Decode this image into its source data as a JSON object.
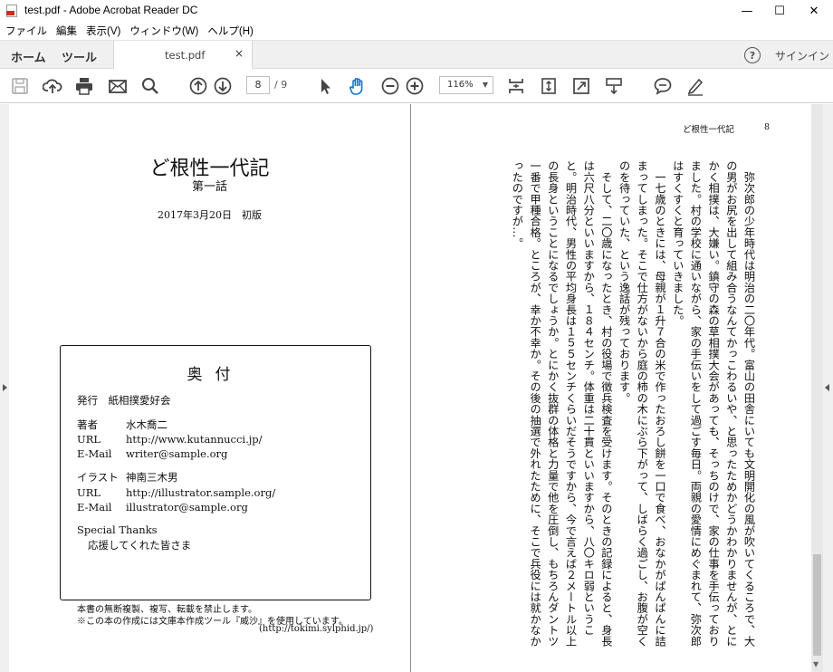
{
  "window": {
    "title": "test.pdf - Adobe Acrobat Reader DC",
    "minimize": "—",
    "maximize": "☐",
    "close": "✕"
  },
  "menu": [
    "ファイル",
    "編集",
    "表示(V)",
    "ウィンドウ(W)",
    "ヘルプ(H)"
  ],
  "tabs": {
    "home": "ホーム",
    "tools": "ツール",
    "document": "test.pdf",
    "close": "×",
    "help": "?",
    "signin": "サインイン"
  },
  "toolbar": {
    "page_current": "8",
    "page_total": "/ 9",
    "zoom": "116%",
    "icons": [
      "save-icon",
      "upload-icon",
      "print-icon",
      "email-icon",
      "search-icon",
      "page-up-icon",
      "page-down-icon",
      "select-arrow-icon",
      "hand-icon",
      "zoom-out-icon",
      "zoom-in-icon",
      "fit-page-icon",
      "scrolling-mode-icon",
      "full-screen-icon",
      "read-mode-icon",
      "comment-icon",
      "sign-icon"
    ]
  },
  "left_page": {
    "title": "ど根性一代記",
    "subtitle": "第一話",
    "date": "2017年3月20日　初版",
    "colophon": {
      "heading": "奥付",
      "publisher": "発行　紙相撲愛好会",
      "author_label": "著者",
      "author": "水木喬二",
      "author_url_label": "URL",
      "author_url": "http://www.kutannucci.jp/",
      "author_mail_label": "E-Mail",
      "author_mail": "writer@sample.org",
      "illust_label": "イラスト",
      "illustrator": "神南三木男",
      "illust_url_label": "URL",
      "illust_url": "http://illustrator.sample.org/",
      "illust_mail_label": "E-Mail",
      "illust_mail": "illustrator@sample.org",
      "thanks_label": "Special Thanks",
      "thanks": "応援してくれた皆さま"
    },
    "notice1": "本書の無断複製、複写、転載を禁止します。",
    "notice2": "※この本の作成には文庫本作成ツール『威沙』を使用しています。",
    "notice3": "(http://tokimi.sylphid.jp/)"
  },
  "right_page": {
    "header": "ど根性一代記",
    "page_number": "8",
    "body": "　弥次郎の少年時代は明治の二〇年代。富山の田舎にいても文明開化の風が吹いてくるころで、大の男がお尻を出して組み合うなんてかっこわるいや、と思ったためかどうかわかりませんが、とにかく相撲は、大嫌い。鎮守の森の草相撲大会があっても、そっちのけで、家の仕事を手伝っておりました。村の学校に通いながら、家の手伝いをして過ごす毎日。両親の愛情にめぐまれて、弥次郎はすくすくと育っていきました。\n　一七歳のときには、母親が１升７合の米で作ったおろし餅を一口で食べ、おなかがぱんぱんに詰まってしまった。そこで仕方がないから庭の柿の木にぶら下がって、しばらく過ごし、お腹が空くのを待っていた、という逸話が残っております。\n　そして、二〇歳になったとき、村の役場で徴兵検査を受けます。そのときの記録によると、身長は六尺八分といいますから、１８４センチ。体重は二十貫といいますから、八〇キロ弱ということ。明治時代、男性の平均身長は１５５センチくらいだそうですから、今で言えば２メートル以上の長身ということになるでしょうか。とにかく抜群の体格と力量で他を圧倒し、もちろんダントツ一番で甲種合格。ところが、幸か不幸か。その後の抽選で外れたために、そこで兵役には就かなかったのですが…。"
  }
}
